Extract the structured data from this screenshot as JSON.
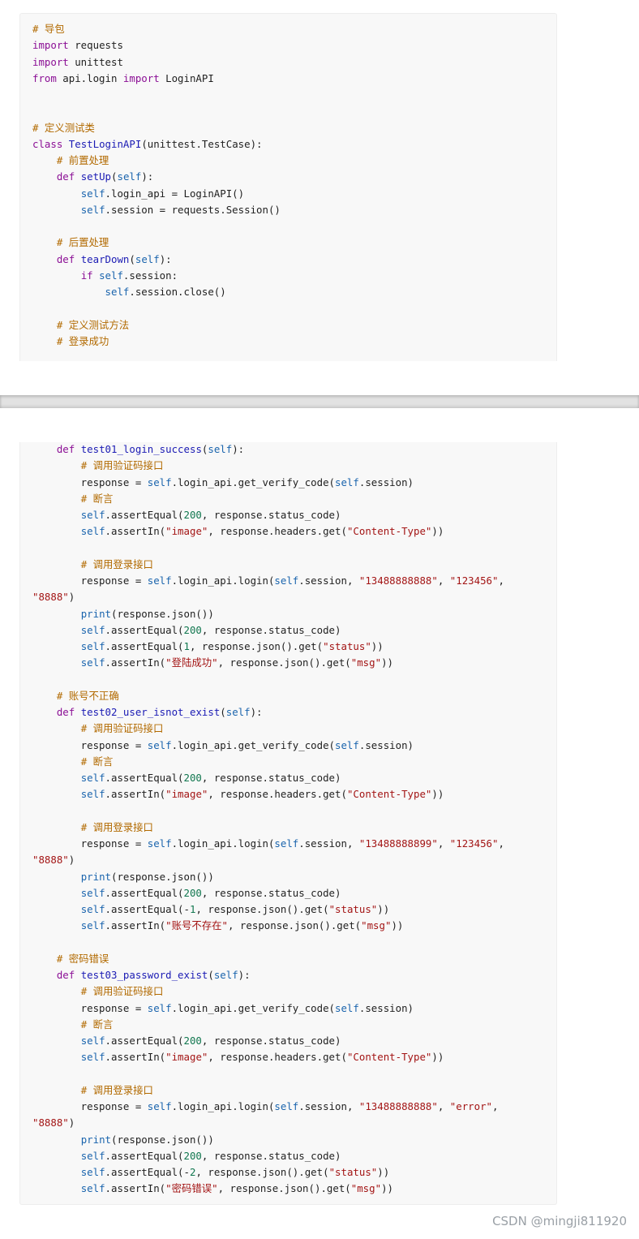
{
  "block1_lines": [
    "# 导包",
    "import requests",
    "import unittest",
    "from api.login import LoginAPI",
    "",
    "",
    "# 定义测试类",
    "class TestLoginAPI(unittest.TestCase):",
    "    # 前置处理",
    "    def setUp(self):",
    "        self.login_api = LoginAPI()",
    "        self.session = requests.Session()",
    "",
    "    # 后置处理",
    "    def tearDown(self):",
    "        if self.session:",
    "            self.session.close()",
    "",
    "    # 定义测试方法",
    "    # 登录成功"
  ],
  "block2_lines": [
    "    def test01_login_success(self):",
    "        # 调用验证码接口",
    "        response = self.login_api.get_verify_code(self.session)",
    "        # 断言",
    "        self.assertEqual(200, response.status_code)",
    "        self.assertIn(\"image\", response.headers.get(\"Content-Type\"))",
    "",
    "        # 调用登录接口",
    "        response = self.login_api.login(self.session, \"13488888888\", \"123456\",",
    "\"8888\")",
    "        print(response.json())",
    "        self.assertEqual(200, response.status_code)",
    "        self.assertEqual(1, response.json().get(\"status\"))",
    "        self.assertIn(\"登陆成功\", response.json().get(\"msg\"))",
    "",
    "    # 账号不正确",
    "    def test02_user_isnot_exist(self):",
    "        # 调用验证码接口",
    "        response = self.login_api.get_verify_code(self.session)",
    "        # 断言",
    "        self.assertEqual(200, response.status_code)",
    "        self.assertIn(\"image\", response.headers.get(\"Content-Type\"))",
    "",
    "        # 调用登录接口",
    "        response = self.login_api.login(self.session, \"13488888899\", \"123456\",",
    "\"8888\")",
    "        print(response.json())",
    "        self.assertEqual(200, response.status_code)",
    "        self.assertEqual(-1, response.json().get(\"status\"))",
    "        self.assertIn(\"账号不存在\", response.json().get(\"msg\"))",
    "",
    "    # 密码错误",
    "    def test03_password_exist(self):",
    "        # 调用验证码接口",
    "        response = self.login_api.get_verify_code(self.session)",
    "        # 断言",
    "        self.assertEqual(200, response.status_code)",
    "        self.assertIn(\"image\", response.headers.get(\"Content-Type\"))",
    "",
    "        # 调用登录接口",
    "        response = self.login_api.login(self.session, \"13488888888\", \"error\",",
    "\"8888\")",
    "        print(response.json())",
    "        self.assertEqual(200, response.status_code)",
    "        self.assertEqual(-2, response.json().get(\"status\"))",
    "        self.assertIn(\"密码错误\", response.json().get(\"msg\"))"
  ],
  "watermark": "CSDN @mingji811920",
  "colors": {
    "keyword": "#8b0f95",
    "function_name": "#1b1bb4",
    "self_builtin": "#1a64ad",
    "string": "#a31515",
    "number": "#11774f",
    "comment": "#b26a00",
    "code_background": "#f8f8f8"
  }
}
